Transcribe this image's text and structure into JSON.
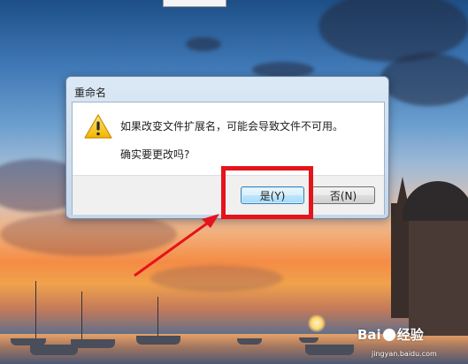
{
  "dialog": {
    "title": "重命名",
    "message": "如果改变文件扩展名，可能会导致文件不可用。",
    "question": "确实要更改吗?",
    "buttons": {
      "yes": "是(Y)",
      "no": "否(N)"
    },
    "icon": "warning-icon"
  },
  "watermark": {
    "brand": "Bai",
    "brand_suffix": "经验",
    "url": "jingyan.baidu.com"
  },
  "colors": {
    "highlight": "#e5131b",
    "dialog_frame": "#c5d6ea",
    "yes_button_border": "#3c7fb1"
  }
}
